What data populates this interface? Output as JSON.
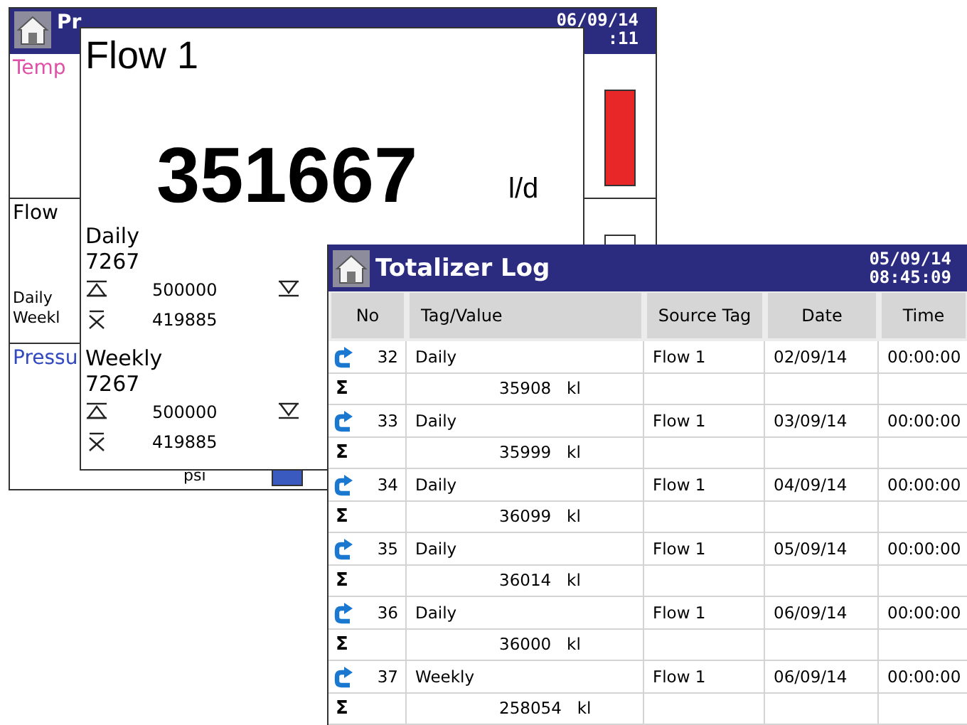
{
  "main_screen": {
    "title": "Pr",
    "date": "06/09/14",
    "time": ":11",
    "sections": [
      {
        "kind": "temperature",
        "label": "Temp",
        "color": "#e050a8"
      },
      {
        "kind": "flow",
        "label": "Flow",
        "color": "#000000",
        "lines": [
          "Daily",
          "Weekl"
        ]
      },
      {
        "kind": "pressure",
        "label": "Pressu",
        "color": "#3048c0",
        "lines": [
          "psi"
        ]
      }
    ]
  },
  "flow_popup": {
    "title": "Flow 1",
    "value": "351667",
    "unit": "l/d",
    "totals": [
      {
        "name": "Daily",
        "value": "7267",
        "max": "500000",
        "avg": "419885"
      },
      {
        "name": "Weekly",
        "value": "7267",
        "max": "500000",
        "avg": "419885"
      }
    ]
  },
  "totalizer_log": {
    "title": "Totalizer Log",
    "date": "05/09/14",
    "time": "08:45:09",
    "columns": [
      "No",
      "Tag/Value",
      "Source Tag",
      "Date",
      "Time"
    ],
    "entries": [
      {
        "no": "32",
        "tag": "Daily",
        "source": "Flow 1",
        "date": "02/09/14",
        "time": "00:00:00",
        "sum_mark": "Σ",
        "total": "35908",
        "unit": "kl"
      },
      {
        "no": "33",
        "tag": "Daily",
        "source": "Flow 1",
        "date": "03/09/14",
        "time": "00:00:00",
        "sum_mark": "Σ",
        "total": "35999",
        "unit": "kl"
      },
      {
        "no": "34",
        "tag": "Daily",
        "source": "Flow 1",
        "date": "04/09/14",
        "time": "00:00:00",
        "sum_mark": "Σ",
        "total": "36099",
        "unit": "kl"
      },
      {
        "no": "35",
        "tag": "Daily",
        "source": "Flow 1",
        "date": "05/09/14",
        "time": "00:00:00",
        "sum_mark": "Σ",
        "total": "36014",
        "unit": "kl"
      },
      {
        "no": "36",
        "tag": "Daily",
        "source": "Flow 1",
        "date": "06/09/14",
        "time": "00:00:00",
        "sum_mark": "Σ",
        "total": "36000",
        "unit": "kl"
      },
      {
        "no": "37",
        "tag": "Weekly",
        "source": "Flow 1",
        "date": "06/09/14",
        "time": "00:00:00",
        "sum_mark": "Σ",
        "total": "258054",
        "unit": "kl"
      }
    ]
  }
}
